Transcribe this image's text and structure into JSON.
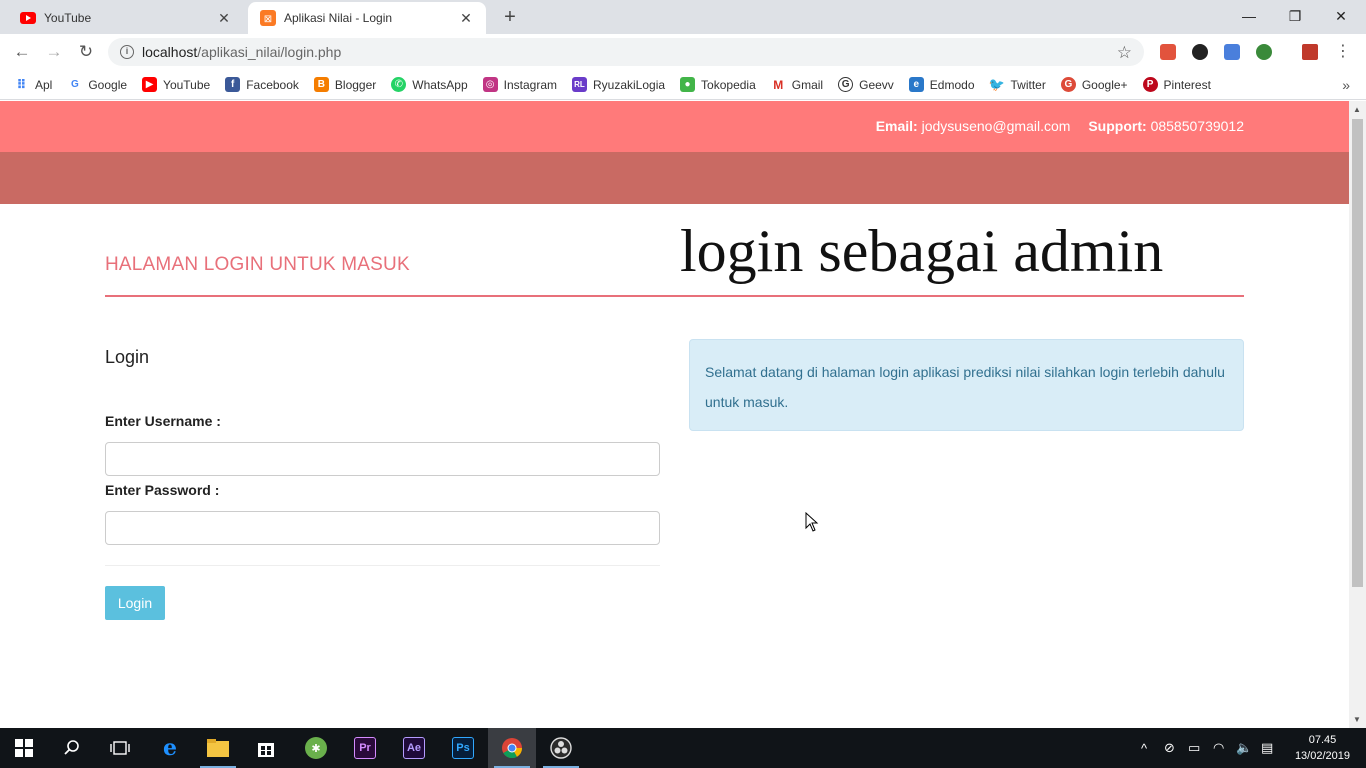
{
  "browser": {
    "tabs": [
      {
        "title": "YouTube",
        "active": false
      },
      {
        "title": "Aplikasi Nilai - Login",
        "active": true
      }
    ],
    "new_tab": "+",
    "window_controls": {
      "minimize": "—",
      "maximize": "❐",
      "close": "✕"
    },
    "url": {
      "host": "localhost",
      "path": "/aplikasi_nilai/login.php"
    },
    "bookmarks": [
      {
        "label": "Apl",
        "icon": "apps-grid-icon",
        "color": "#4285f4"
      },
      {
        "label": "Google",
        "icon": "google-icon",
        "color": "#4285f4"
      },
      {
        "label": "YouTube",
        "icon": "youtube-icon",
        "color": "#ff0000"
      },
      {
        "label": "Facebook",
        "icon": "facebook-icon",
        "color": "#3b5998"
      },
      {
        "label": "Blogger",
        "icon": "blogger-icon",
        "color": "#f57d00"
      },
      {
        "label": "WhatsApp",
        "icon": "whatsapp-icon",
        "color": "#25d366"
      },
      {
        "label": "Instagram",
        "icon": "instagram-icon",
        "color": "#c13584"
      },
      {
        "label": "RyuzakiLogia",
        "icon": "ryuzakilogia-icon",
        "color": "#6a3cc9"
      },
      {
        "label": "Tokopedia",
        "icon": "tokopedia-icon",
        "color": "#42b549"
      },
      {
        "label": "Gmail",
        "icon": "gmail-icon",
        "color": "#d93025"
      },
      {
        "label": "Geevv",
        "icon": "geevv-icon",
        "color": "#333333"
      },
      {
        "label": "Edmodo",
        "icon": "edmodo-icon",
        "color": "#2a78c9"
      },
      {
        "label": "Twitter",
        "icon": "twitter-icon",
        "color": "#1da1f2"
      },
      {
        "label": "Google+",
        "icon": "google-plus-icon",
        "color": "#dd4b39"
      },
      {
        "label": "Pinterest",
        "icon": "pinterest-icon",
        "color": "#bd081c"
      }
    ],
    "bookmarks_more": "»"
  },
  "page": {
    "contact": {
      "email_label": "Email:",
      "email": "jodysuseno@gmail.com",
      "support_label": "Support:",
      "support": "085850739012"
    },
    "heading": "HALAMAN LOGIN UNTUK MASUK",
    "overlay_title": "login sebagai admin",
    "form": {
      "title": "Login",
      "username_label": "Enter Username :",
      "username_value": "",
      "password_label": "Enter Password :",
      "password_value": "",
      "submit_label": "Login"
    },
    "alert": "Selamat datang di halaman login aplikasi prediksi nilai silahkan login terlebih dahulu untuk masuk.",
    "colors": {
      "topbar": "#ff7a7a",
      "subbar": "#c96a63",
      "heading": "#e8707a",
      "button": "#5bc0de",
      "alert_bg": "#d9edf7",
      "alert_text": "#31708f"
    }
  },
  "taskbar": {
    "apps": [
      "windows-start-icon",
      "search-icon",
      "task-view-icon",
      "edge-icon",
      "file-explorer-icon",
      "store-icon",
      "xampp-icon",
      "premiere-icon",
      "after-effects-icon",
      "photoshop-icon",
      "chrome-icon",
      "obs-icon"
    ],
    "clock": {
      "time": "07.45",
      "date": "13/02/2019"
    }
  }
}
